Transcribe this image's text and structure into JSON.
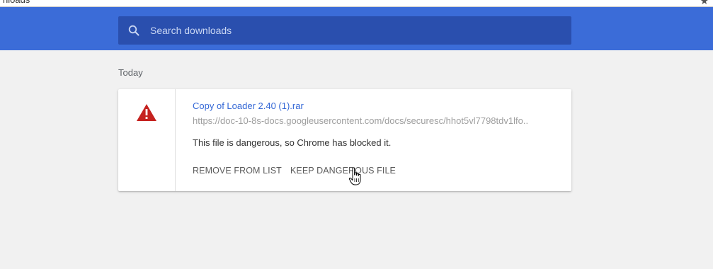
{
  "omnibox": {
    "text": "nloads"
  },
  "search": {
    "placeholder": "Search downloads",
    "value": ""
  },
  "section": {
    "date_label": "Today"
  },
  "download_item": {
    "file_name": "Copy of Loader 2.40 (1).rar",
    "url": "https://doc-10-8s-docs.googleusercontent.com/docs/securesc/hhot5vl7798tdv1lfo..",
    "status_text": "This file is dangerous, so Chrome has blocked it.",
    "remove_label": "REMOVE FROM LIST",
    "keep_label": "KEEP DANGEROUS FILE",
    "warning_color": "#c5221f"
  },
  "colors": {
    "toolbar": "#3b6cd8",
    "search_box": "#2a4fae",
    "link": "#3367d6",
    "background": "#f1f1f1"
  },
  "icons": {
    "omnibox_star": "star-icon",
    "search": "search-icon",
    "warning": "warning-icon",
    "cursor": "hand-cursor-icon"
  }
}
